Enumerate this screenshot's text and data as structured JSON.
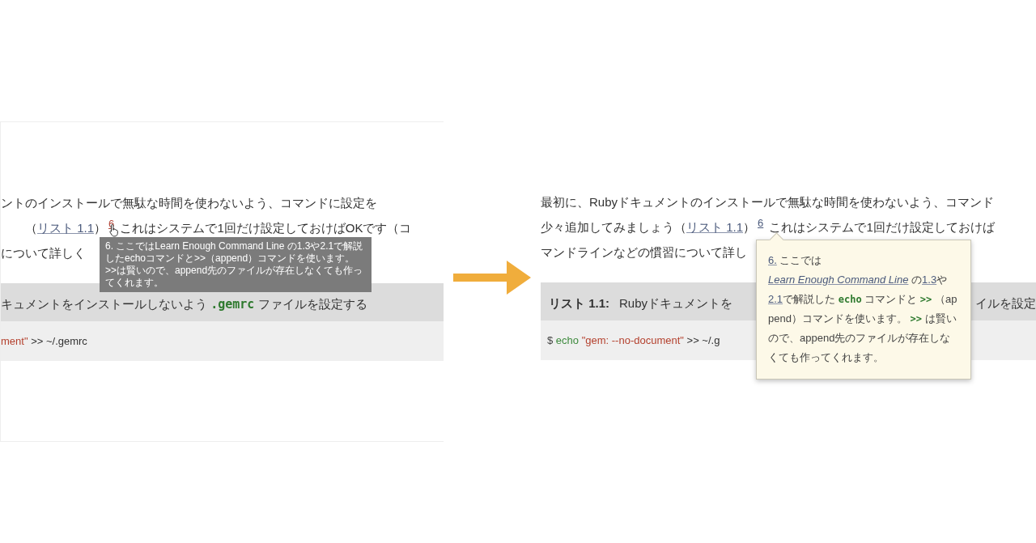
{
  "before": {
    "lines": [
      {
        "segments": [
          {
            "kind": "text",
            "text": "ントのインストールで無駄な時間を使わないよう、コマンドに設定を"
          }
        ]
      },
      {
        "segments": [
          {
            "kind": "text",
            "text": "（"
          },
          {
            "kind": "link",
            "text": "リスト 1.1"
          },
          {
            "kind": "text",
            "text": "）"
          },
          {
            "kind": "footnote",
            "text": "6"
          },
          {
            "kind": "text",
            "text": " これはシステムで1回だけ設定しておけばOKです（コ"
          }
        ]
      },
      {
        "segments": [
          {
            "kind": "text",
            "text": "について詳しく"
          }
        ]
      }
    ],
    "tooltip": {
      "text": "6. ここではLearn Enough Command Line の1.3や2.1で解説したechoコマンドと>>（append）コマンドを使います。>>は賢いので、append先のファイルが存在しなくても作ってくれます。"
    },
    "listing": {
      "caption": [
        {
          "kind": "text",
          "text": "キュメントをインストールしないよう "
        },
        {
          "kind": "code",
          "text": ".gemrc"
        },
        {
          "kind": "text",
          "text": " ファイルを設定する"
        }
      ],
      "code": [
        {
          "kind": "string",
          "text": "ment\""
        },
        {
          "kind": "text",
          "text": " >> ~/.gemrc"
        }
      ]
    }
  },
  "after": {
    "lines": [
      {
        "segments": [
          {
            "kind": "text",
            "text": "最初に、Rubyドキュメントのインストールで無駄な時間を使わないよう、コマンド"
          }
        ]
      },
      {
        "segments": [
          {
            "kind": "text",
            "text": "少々追加してみましょう（"
          },
          {
            "kind": "link",
            "text": "リスト 1.1"
          },
          {
            "kind": "text",
            "text": "）"
          },
          {
            "kind": "footnote",
            "text": "6"
          },
          {
            "kind": "text",
            "text": " これはシステムで1回だけ設定しておけば"
          }
        ]
      },
      {
        "segments": [
          {
            "kind": "text",
            "text": "マンドラインなどの慣習について詳し"
          }
        ]
      }
    ],
    "tooltip": {
      "segments": [
        {
          "kind": "link",
          "text": "6."
        },
        {
          "kind": "text",
          "text": " ここでは"
        },
        {
          "kind": "italic-link",
          "text": "Learn Enough Command Line"
        },
        {
          "kind": "text",
          "text": " の"
        },
        {
          "kind": "link",
          "text": "1.3"
        },
        {
          "kind": "text",
          "text": "や"
        },
        {
          "kind": "link",
          "text": "2.1"
        },
        {
          "kind": "text",
          "text": "で解説した "
        },
        {
          "kind": "code",
          "text": "echo"
        },
        {
          "kind": "text",
          "text": " コマンドと "
        },
        {
          "kind": "code",
          "text": ">>"
        },
        {
          "kind": "text",
          "text": " （append）コマンドを使います。 "
        },
        {
          "kind": "code",
          "text": ">>"
        },
        {
          "kind": "text",
          "text": " は賢いので、append先のファイルが存在しなくても作ってくれます。"
        }
      ]
    },
    "listing": {
      "label": "リスト 1.1:",
      "caption": "Rubyドキュメントを",
      "caption_tail": "イルを設定",
      "code": [
        {
          "kind": "prompt",
          "text": "$ "
        },
        {
          "kind": "keyword",
          "text": "echo "
        },
        {
          "kind": "string",
          "text": "\"gem: --no-document\""
        },
        {
          "kind": "text",
          "text": " >> ~/.g"
        }
      ]
    }
  }
}
